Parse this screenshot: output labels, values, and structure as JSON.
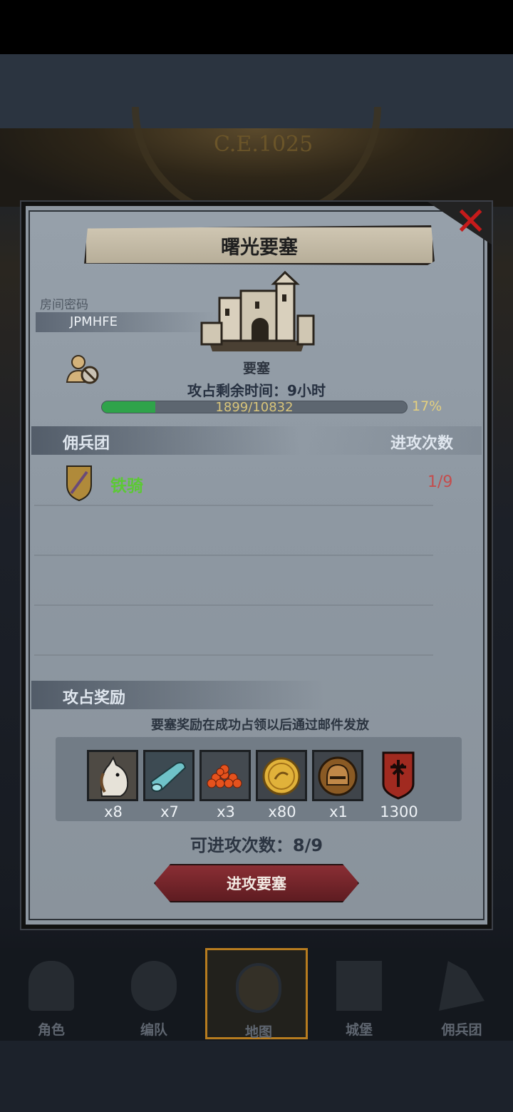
{
  "background": {
    "dial_text": "C.E.1025"
  },
  "dialog": {
    "title": "曙光要塞",
    "room": {
      "label": "房间密码",
      "code": "JPMHFE"
    },
    "building_type": "要塞",
    "time_remaining": "攻占剩余时间：9小时",
    "progress": {
      "text": "1899/10832",
      "percent_text": "17%",
      "fraction": 0.175
    },
    "mercenaries": {
      "header_left": "佣兵团",
      "header_right": "进攻次数",
      "rows": [
        {
          "name": "铁骑",
          "count": "1/9"
        }
      ]
    },
    "rewards": {
      "title": "攻占奖励",
      "note": "要塞奖励在成功占领以后通过邮件发放",
      "items": [
        {
          "icon": "horse-icon",
          "qty": "x8"
        },
        {
          "icon": "cloth-roll-icon",
          "qty": "x7"
        },
        {
          "icon": "caviar-icon",
          "qty": "x3"
        },
        {
          "icon": "gold-coin-icon",
          "qty": "x80"
        },
        {
          "icon": "helmet-icon",
          "qty": "x1"
        },
        {
          "icon": "banner-emblem-icon",
          "qty": "1300"
        }
      ]
    },
    "attempts": "可进攻次数：8/9",
    "attack_button": "进攻要塞"
  },
  "nav": [
    {
      "label": "角色",
      "icon": "knight-icon"
    },
    {
      "label": "编队",
      "icon": "helmet-icon"
    },
    {
      "label": "地图",
      "icon": "compass-icon"
    },
    {
      "label": "城堡",
      "icon": "castle-icon"
    },
    {
      "label": "佣兵团",
      "icon": "ship-icon"
    }
  ],
  "colors": {
    "accent_green": "#5cc935",
    "count_red": "#c44d4d",
    "button_red": "#8a2e34"
  }
}
